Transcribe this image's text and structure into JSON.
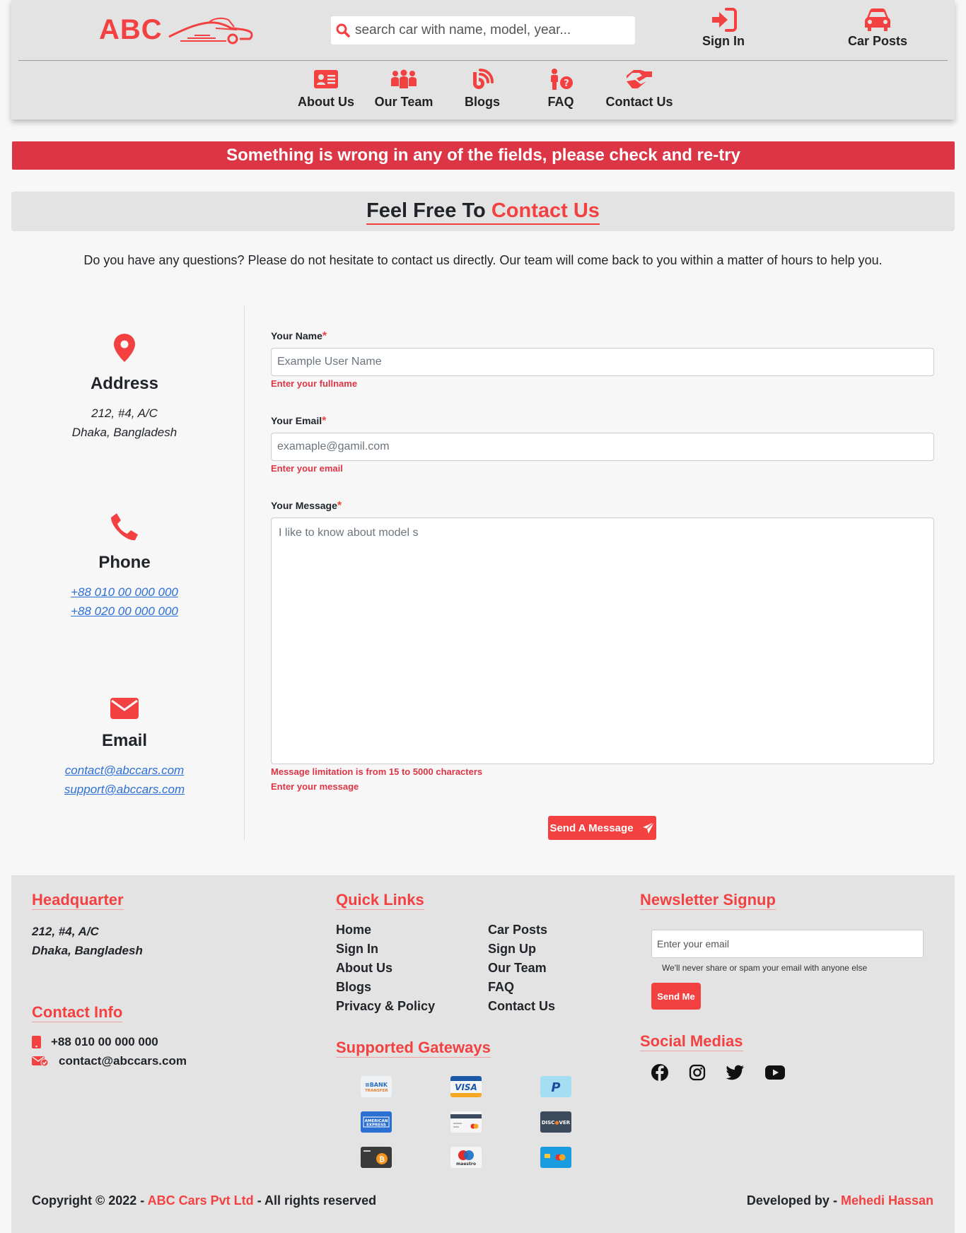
{
  "brand": {
    "logo_text": "ABC",
    "accent": "#f34141"
  },
  "header": {
    "search_placeholder": "search car with name, model, year...",
    "sign_in": "Sign In",
    "car_posts": "Car Posts",
    "nav": [
      {
        "label": "About Us",
        "icon": "id-card-icon"
      },
      {
        "label": "Our Team",
        "icon": "people-group-icon"
      },
      {
        "label": "Blogs",
        "icon": "blog-icon"
      },
      {
        "label": "FAQ",
        "icon": "person-question-icon"
      },
      {
        "label": "Contact Us",
        "icon": "handshake-icon"
      }
    ]
  },
  "alert": {
    "text": "Something is wrong in any of the fields, please check and re-try",
    "color": "#dc3545"
  },
  "contact": {
    "title_prefix": "Feel Free To",
    "title_accent": "Contact Us",
    "intro": "Do you have any questions? Please do not hesitate to contact us directly. Our team will come back to you within a matter of hours to help you.",
    "address": {
      "heading": "Address",
      "line1": "212, #4, A/C",
      "line2": "Dhaka, Bangladesh"
    },
    "phone": {
      "heading": "Phone",
      "line1": "+88 010 00 000 000",
      "line2": "+88 020 00 000 000"
    },
    "email": {
      "heading": "Email",
      "line1": "contact@abccars.com",
      "line2": "support@abccars.com"
    }
  },
  "form": {
    "name_label": "Your Name",
    "name_placeholder": "Example User Name",
    "name_error": "Enter your fullname",
    "email_label": "Your Email",
    "email_placeholder": "examaple@gamil.com",
    "email_error": "Enter your email",
    "message_label": "Your Message",
    "message_value": "I like to know about model s",
    "message_error_limit": "Message limitation is from 15 to 5000 characters",
    "message_error": "Enter your message",
    "required_mark": "*",
    "send_label": "Send A Message"
  },
  "footer": {
    "hq_heading": "Headquarter",
    "hq_line1": "212, #4, A/C",
    "hq_line2": "Dhaka, Bangladesh",
    "contact_heading": "Contact Info",
    "contact_phone": "+88 010 00 000 000",
    "contact_email": "contact@abccars.com",
    "quick_heading": "Quick Links",
    "quick_col1": [
      "Home",
      "Sign In",
      "About Us",
      "Blogs",
      "Privacy & Policy"
    ],
    "quick_col2": [
      "Car Posts",
      "Sign Up",
      "Our Team",
      "FAQ",
      "Contact Us"
    ],
    "gateways_heading": "Supported Gateways",
    "gateways": [
      "bank-transfer",
      "visa",
      "paypal",
      "american-express",
      "generic-card",
      "discover",
      "bitcoin",
      "maestro",
      "mastercard"
    ],
    "newsletter_heading": "Newsletter Signup",
    "newsletter_placeholder": "Enter your email",
    "newsletter_note": "We'll never share or spam your email with anyone else",
    "newsletter_button": "Send Me",
    "social_heading": "Social Medias",
    "social": [
      "facebook-icon",
      "instagram-icon",
      "twitter-icon",
      "youtube-icon"
    ],
    "copyright_prefix": "Copyright © 2022 -",
    "copyright_company": "ABC Cars Pvt Ltd",
    "copyright_suffix": "- All rights reserved",
    "developed_prefix": "Developed by -",
    "developer": "Mehedi Hassan"
  }
}
